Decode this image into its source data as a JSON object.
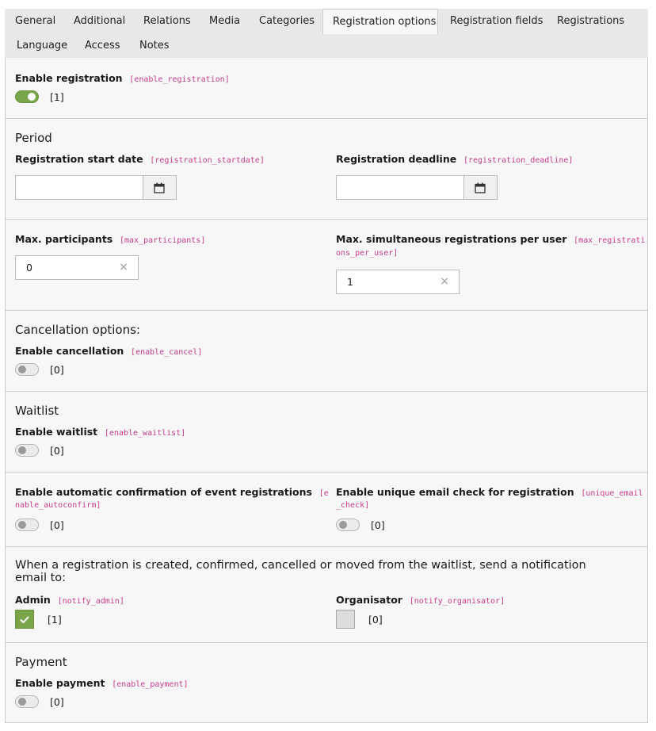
{
  "tabs": [
    {
      "label": "General"
    },
    {
      "label": "Additional"
    },
    {
      "label": "Relations"
    },
    {
      "label": "Media"
    },
    {
      "label": "Categories"
    },
    {
      "label": "Registration options"
    },
    {
      "label": "Registration fields"
    },
    {
      "label": "Registrations"
    },
    {
      "label": "Language"
    },
    {
      "label": "Access"
    },
    {
      "label": "Notes"
    }
  ],
  "enable_registration": {
    "label": "Enable registration",
    "key": "[enable_registration]",
    "state": "[1]"
  },
  "period": {
    "heading": "Period",
    "start": {
      "label": "Registration start date",
      "key": "[registration_startdate]",
      "value": ""
    },
    "deadline": {
      "label": "Registration deadline",
      "key": "[registration_deadline]",
      "value": ""
    }
  },
  "max_participants": {
    "label": "Max. participants",
    "key": "[max_participants]",
    "value": "0"
  },
  "max_per_user": {
    "label": "Max. simultaneous registrations per user",
    "key_part1": "[max_registrati",
    "key_part2": "ons_per_user]",
    "value": "1"
  },
  "cancellation": {
    "heading": "Cancellation options:",
    "label": "Enable cancellation",
    "key": "[enable_cancel]",
    "state": "[0]"
  },
  "waitlist": {
    "heading": "Waitlist",
    "label": "Enable waitlist",
    "key": "[enable_waitlist]",
    "state": "[0]"
  },
  "autoconfirm": {
    "label": "Enable automatic confirmation of event registrations",
    "key_part1": "[e",
    "key_part2": "nable_autoconfirm]",
    "state": "[0]"
  },
  "unique_email": {
    "label": "Enable unique email check for registration",
    "key_part1": "[unique_email",
    "key_part2": "_check]",
    "state": "[0]"
  },
  "notify": {
    "heading_line1": "When a registration is created, confirmed, cancelled or moved from the waitlist, send a notification",
    "heading_line2": "email to:",
    "admin": {
      "label": "Admin",
      "key": "[notify_admin]",
      "state": "[1]"
    },
    "organisator": {
      "label": "Organisator",
      "key": "[notify_organisator]",
      "state": "[0]"
    }
  },
  "payment": {
    "heading": "Payment",
    "label": "Enable payment",
    "key": "[enable_payment]",
    "state": "[0]"
  },
  "icons": {
    "calendar": "calendar-icon",
    "clear": "clear-icon",
    "check": "checkmark-icon"
  },
  "colors": {
    "accent": "#79a548",
    "key": "#c43d8b"
  }
}
